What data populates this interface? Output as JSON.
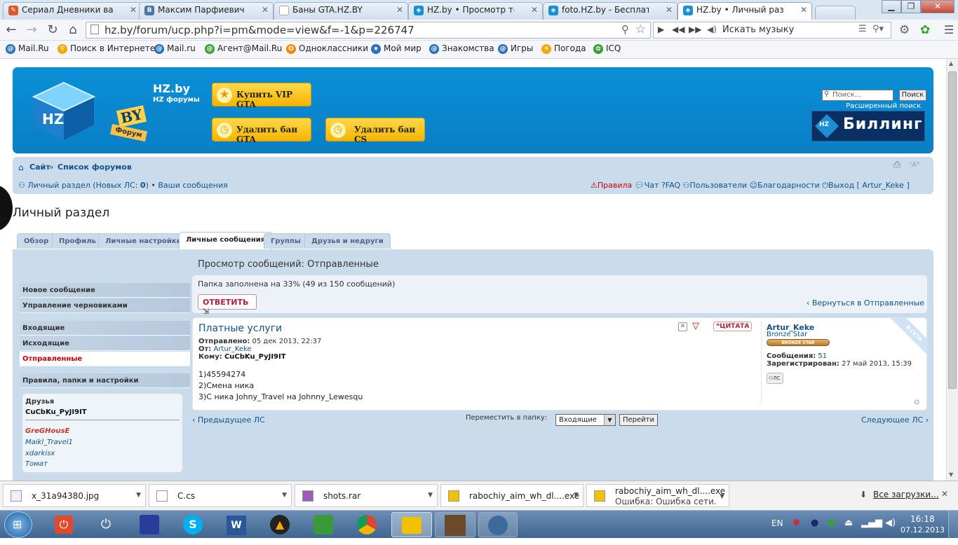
{
  "browser": {
    "tabs": [
      {
        "label": "Сериал Дневники вампи",
        "icon": "blog-favicon",
        "color": "#e0562a",
        "active": false
      },
      {
        "label": "Максим Парфиевич",
        "icon": "vk-favicon",
        "color": "#4a76a8",
        "active": false
      },
      {
        "label": "Баны GTA.HZ.BY",
        "icon": "page-favicon",
        "color": "#999999",
        "active": false
      },
      {
        "label": "HZ.by • Просмотр темы",
        "icon": "hz-favicon",
        "color": "#1a8fd6",
        "active": false
      },
      {
        "label": "foto.HZ.by - Бесплатный",
        "icon": "hz-favicon",
        "color": "#1a8fd6",
        "active": false
      },
      {
        "label": "HZ.by • Личный раздел -",
        "icon": "hz-favicon",
        "color": "#1a8fd6",
        "active": true
      }
    ],
    "url": "hz.by/forum/ucp.php?i=pm&mode=view&f=-1&p=226747",
    "music_placeholder": "Искать музыку",
    "bookmarks": [
      {
        "label": "Mail.Ru",
        "icon": "mailru-icon",
        "color": "#2b6fbf"
      },
      {
        "label": "Поиск в Интернете",
        "icon": "search-icon",
        "color": "#f2a900"
      },
      {
        "label": "Mail.ru",
        "icon": "mailru-icon",
        "color": "#2b6fbf"
      },
      {
        "label": "Агент@Mail.Ru",
        "icon": "agent-icon",
        "color": "#3aa035"
      },
      {
        "label": "Одноклассники",
        "icon": "ok-icon",
        "color": "#f28d00"
      },
      {
        "label": "Мой мир",
        "icon": "myworld-icon",
        "color": "#2b6fbf"
      },
      {
        "label": "Знакомства",
        "icon": "dating-icon",
        "color": "#2b6fbf"
      },
      {
        "label": "Игры",
        "icon": "games-icon",
        "color": "#2b6fbf"
      },
      {
        "label": "Погода",
        "icon": "weather-icon",
        "color": "#f2a900"
      },
      {
        "label": "ICQ",
        "icon": "icq-icon",
        "color": "#3aa035"
      }
    ]
  },
  "site": {
    "name": "HZ.by",
    "tagline": "HZ форумы",
    "logo_text": "HZ",
    "logo_suffix": "BY",
    "logo_forum": "Форум",
    "buttons": {
      "vip": "Купить VIP GTA",
      "unban_gta": "Удалить бан GTA",
      "unban_cs": "Удалить бан CS"
    },
    "search_placeholder": "Поиск...",
    "search_button": "Поиск",
    "advanced_search": "Расширенный поиск",
    "billing": "Биллинг",
    "billing_mark": "HZ"
  },
  "breadcrumb": {
    "site": "Сайт",
    "sep": "»",
    "forums": "Список форумов"
  },
  "userbar": {
    "personal": "Личный раздел (Новых ЛС: ",
    "new_count": "0",
    "personal_close": ")",
    "bullet": "•",
    "your_messages": "Ваши сообщения",
    "rules": "Правила",
    "chat": "Чат",
    "faq": "FAQ",
    "users": "Пользователи",
    "thanks": "Благодарности",
    "logout": "Выход [",
    "username": "Artur_Keke",
    "logout_close": "]",
    "font_size": "A"
  },
  "page_title": "Личный раздел",
  "ucp_tabs": [
    "Обзор",
    "Профиль",
    "Личные настройки",
    "Личные сообщения",
    "Группы",
    "Друзья и недруги"
  ],
  "menu": {
    "new_message": "Новое сообщение",
    "drafts": "Управление черновиками",
    "inbox": "Входящие",
    "outbox": "Исходящие",
    "sent": "Отправленные",
    "rules": "Правила, папки и настройки"
  },
  "friends": {
    "title": "Друзья",
    "online_user": "CuCbKu_PyJI9IT",
    "offline": [
      "GreGHousE",
      "Maikl_Travel1",
      "xdarkisx",
      "Томат"
    ]
  },
  "main": {
    "heading": "Просмотр сообщений: Отправленные",
    "folder_status": "Папка заполнена на 33% (49 из 150 сообщений)",
    "reply_button": "ОТВЕТИТЬ",
    "back_link": "Вернуться в Отправленные",
    "message": {
      "subject": "Платные услуги",
      "sent_label": "Отправлено:",
      "sent_value": "05 дек 2013, 22:37",
      "from_label": "От:",
      "from_value": "Artur_Keke",
      "to_label": "Кому:",
      "to_value": "CuCbKu_PyJI9IT",
      "lines": [
        "1)45594274",
        "2)Смена ника",
        "3)С ника Johny_Travel на Johnny_Lewesqu"
      ],
      "quote_button": "ЦИТАТА"
    },
    "author": {
      "name": "Artur_Keke",
      "rank": "Bronze Star",
      "rank_badge": "BRONZE STAR",
      "posts_label": "Сообщения:",
      "posts": "51",
      "registered_label": "Зарегистрирован:",
      "registered": "27 май 2013, 15:39",
      "online_ribbon": "В СЕТИ",
      "pm_button": "ЛС"
    },
    "prev": "Предыдущее ЛС",
    "next": "Следующее ЛС",
    "move_label": "Переместить в папку:",
    "move_select": "Входящие",
    "move_button": "Перейти"
  },
  "downloads": {
    "items": [
      {
        "name": "x_31a94380.jpg",
        "status": ""
      },
      {
        "name": "C.cs",
        "status": ""
      },
      {
        "name": "shots.rar",
        "status": ""
      },
      {
        "name": "rabochiy_aim_wh_dl....exe",
        "status": ""
      },
      {
        "name": "rabochiy_aim_wh_dl....exe",
        "status": "Ошибка: Ошибка сети."
      }
    ],
    "all": "Все загрузки..."
  },
  "taskbar": {
    "lang": "EN",
    "time": "16:18",
    "date": "07.12.2013"
  }
}
